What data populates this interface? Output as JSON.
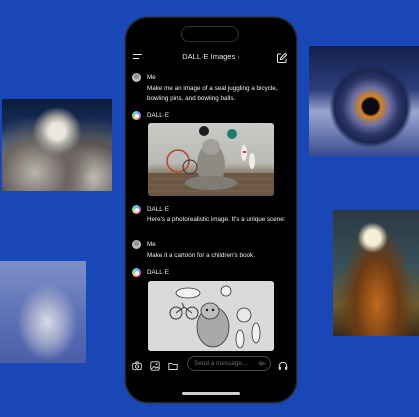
{
  "header": {
    "title": "DALL·E Images",
    "chevron": "›"
  },
  "messages": [
    {
      "sender": "Me",
      "text": "Make me an image of a seal juggling a bicycle, bowling pins, and bowling balls."
    },
    {
      "sender": "DALL·E"
    },
    {
      "sender": "DALL·E",
      "text": "Here's a photorealistic image. It's a unique scene:"
    },
    {
      "sender": "Me",
      "text": "Make it a cartoon for a children's book."
    },
    {
      "sender": "DALL·E"
    }
  ],
  "composer": {
    "placeholder": "Send a message..."
  },
  "colors": {
    "background": "#1947b8",
    "phone": "#000000"
  }
}
